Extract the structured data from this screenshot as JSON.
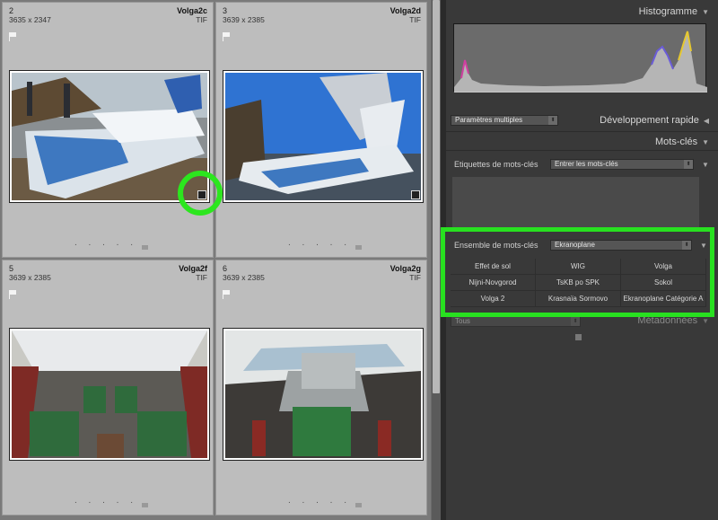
{
  "grid": {
    "cells": [
      {
        "num": "2",
        "dims": "3635 x 2347",
        "name": "Volga2c",
        "ext": "TIF"
      },
      {
        "num": "3",
        "dims": "3639 x 2385",
        "name": "Volga2d",
        "ext": "TIF"
      },
      {
        "num": "5",
        "dims": "3639 x 2385",
        "name": "Volga2f",
        "ext": "TIF"
      },
      {
        "num": "6",
        "dims": "3639 x 2385",
        "name": "Volga2g",
        "ext": "TIF"
      }
    ],
    "dots": ". . . . ."
  },
  "panel": {
    "histogram_title": "Histogramme",
    "quick_dev_select": "Paramètres multiples",
    "quick_dev_title": "Développement rapide",
    "keywords_title": "Mots-clés",
    "tags_label": "Etiquettes de mots-clés",
    "tags_select": "Entrer les mots-clés",
    "set_label": "Ensemble de mots-clés",
    "set_select": "Ekranoplane",
    "keywords": [
      "Effet de sol",
      "WIG",
      "Volga",
      "Nijni-Novgorod",
      "TsKB po SPK",
      "Sokol",
      "Volga 2",
      "Krasnaïa Sormovo",
      "Ekranoplane Catégorie A"
    ],
    "metadata_title": "Métadonnées",
    "metadata_left": "Tous"
  },
  "colors": {
    "highlight": "#28e020",
    "panel": "#393939",
    "cell": "#bdbdbd"
  },
  "icons": [
    "flag-icon",
    "badge-icon",
    "triangle-icon",
    "dropdown-arrow-icon"
  ]
}
